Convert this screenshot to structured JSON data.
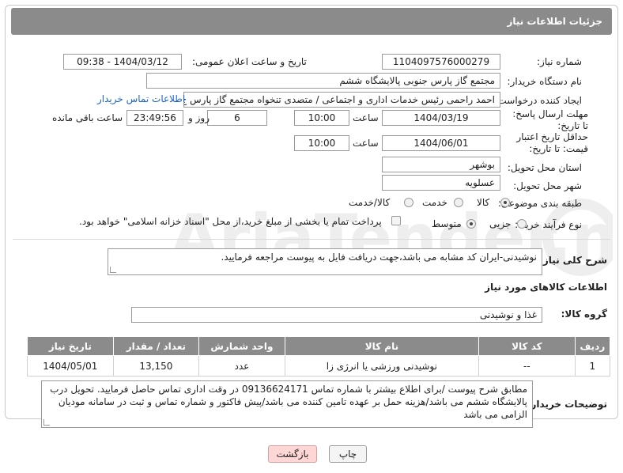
{
  "header": {
    "title": "جزئیات اطلاعات نیاز"
  },
  "fields": {
    "need_number_label": "شماره نیاز:",
    "need_number": "1104097576000279",
    "announce_label": "تاریخ و ساعت اعلان عمومی:",
    "announce_value": "1404/03/12 - 09:38",
    "buyer_org_label": "نام دستگاه خریدار:",
    "buyer_org": "مجتمع گاز پارس جنوبی  پالایشگاه ششم",
    "creator_label": "ایجاد کننده درخواست:",
    "creator": "احمد راحمی رئیس خدمات اداری و اجتماعی / متصدی تنخواه مجتمع گاز پارس ج",
    "contact_link": "اطلاعات تماس خریدار",
    "reply_deadline_label": "مهلت ارسال پاسخ: تا تاریخ:",
    "reply_date": "1404/03/19",
    "time_label": "ساعت",
    "reply_time": "10:00",
    "days_value": "6",
    "days_label": "روز و",
    "remaining_time": "23:49:56",
    "remaining_label": "ساعت باقی مانده",
    "price_validity_label": "حداقل تاریخ اعتبار قیمت: تا تاریخ:",
    "price_date": "1404/06/01",
    "price_time": "10:00",
    "province_label": "استان محل تحویل:",
    "province": "بوشهر",
    "city_label": "شهر محل تحویل:",
    "city": "عسلویه",
    "category_label": "طبقه بندی موضوعی:",
    "category_options": [
      "کالا",
      "خدمت",
      "کالا/خدمت"
    ],
    "purchase_type_label": "نوع فرآیند خرید :",
    "purchase_options": [
      "جزیی",
      "متوسط"
    ],
    "payment_note": "پرداخت تمام یا بخشی از مبلغ خرید،از محل \"اسناد خزانه اسلامی\" خواهد بود.",
    "desc_label": "شرح کلی نیاز:",
    "desc": "نوشیدنی-ایران کد مشابه می باشد،جهت دریافت فایل به پیوست مراجعه فرمایید.",
    "goods_info_title": "اطلاعات کالاهای مورد نیاز",
    "goods_group_label": "گروه کالا:",
    "goods_group": "غذا و نوشیدنی",
    "buyer_notes_label": "توضیحات خریدار:",
    "buyer_notes": "مطابق شرح پیوست /برای اطلاع بیشتر با شماره تماس 09136624171 در وقت اداری تماس حاصل فرمایید. تحویل درب پالایشگاه ششم می باشد/هزینه حمل بر عهده تامین کننده می باشد/پیش فاکتور و شماره تماس و ثبت در سامانه مودیان الزامی می باشد"
  },
  "table": {
    "headers": [
      "ردیف",
      "کد کالا",
      "نام کالا",
      "واحد شمارش",
      "تعداد / مقدار",
      "تاریخ نیاز"
    ],
    "rows": [
      [
        "1",
        "--",
        "نوشیدنی ورزشی یا انرژی زا",
        "عدد",
        "13,150",
        "1404/05/01"
      ]
    ]
  },
  "buttons": {
    "print": "چاپ",
    "back": "بازگشت"
  },
  "watermark": "AriaTender.net"
}
